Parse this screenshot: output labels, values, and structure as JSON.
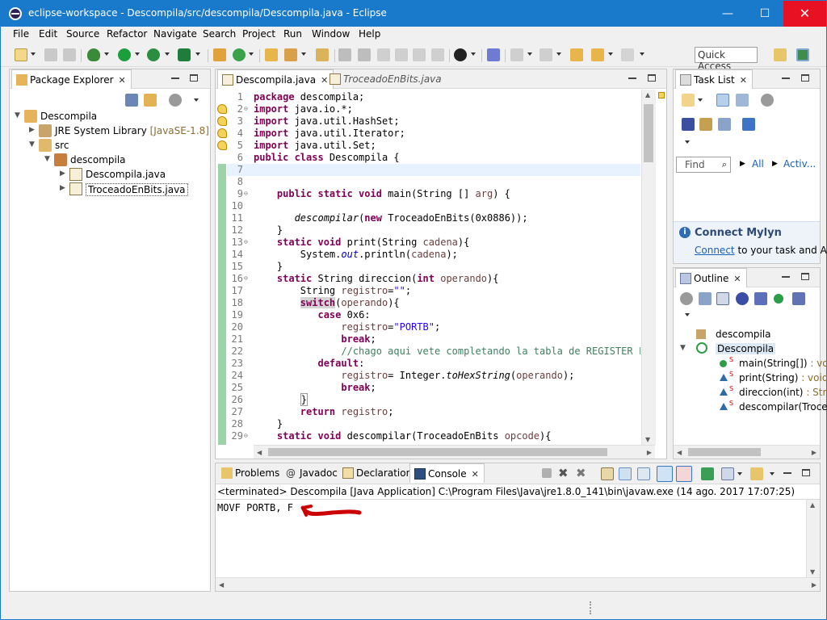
{
  "window": {
    "title": "eclipse-workspace - Descompila/src/descompila/Descompila.java - Eclipse",
    "minimize": "—",
    "maximize": "☐",
    "close": "✕"
  },
  "menu": [
    "File",
    "Edit",
    "Source",
    "Refactor",
    "Navigate",
    "Search",
    "Project",
    "Run",
    "Window",
    "Help"
  ],
  "toolbar": {
    "quick_access_placeholder": "Quick Access"
  },
  "package_explorer": {
    "tab_label": "Package Explorer",
    "tree": [
      {
        "label": "Descompila",
        "decor": "",
        "level": 0
      },
      {
        "label": "JRE System Library",
        "decor": "[JavaSE-1.8]",
        "level": 1
      },
      {
        "label": "src",
        "decor": "",
        "level": 1
      },
      {
        "label": "descompila",
        "decor": "",
        "level": 2
      },
      {
        "label": "Descompila.java",
        "decor": "",
        "level": 3
      },
      {
        "label": "TroceadoEnBits.java",
        "decor": "",
        "level": 3
      }
    ]
  },
  "editor": {
    "tabs": [
      {
        "label": "Descompila.java",
        "active": true
      },
      {
        "label": "TroceadoEnBits.java",
        "active": false
      }
    ],
    "line_numbers": [
      "1",
      "2",
      "3",
      "4",
      "5",
      "6",
      "7",
      "8",
      "9",
      "10",
      "11",
      "12",
      "13",
      "14",
      "15",
      "16",
      "17",
      "18",
      "19",
      "20",
      "21",
      "22",
      "23",
      "24",
      "25",
      "26",
      "27",
      "28",
      "29"
    ]
  },
  "task_list": {
    "tab_label": "Task List",
    "find_placeholder": "Find",
    "all_label": "All",
    "activate_label": "Activ...",
    "connect_title": "Connect Mylyn",
    "connect_link": "Connect",
    "connect_text": " to your task and ALM"
  },
  "outline": {
    "tab_label": "Outline",
    "items": [
      {
        "label": "descompila",
        "type": "",
        "level": 0
      },
      {
        "label": "Descompila",
        "type": "",
        "level": 0
      },
      {
        "label": "main(String[])",
        "type": " : void",
        "level": 1
      },
      {
        "label": "print(String)",
        "type": " : void",
        "level": 1
      },
      {
        "label": "direccion(int)",
        "type": " : String",
        "level": 1
      },
      {
        "label": "descompilar(Troce",
        "type": "",
        "level": 1
      }
    ]
  },
  "console": {
    "tabs": [
      "Problems",
      "Javadoc",
      "Declaration",
      "Console"
    ],
    "terminated": "<terminated> Descompila [Java Application] C:\\Program Files\\Java\\jre1.8.0_141\\bin\\javaw.exe (14 ago. 2017 17:07:25)",
    "output": "MOVF PORTB, F"
  },
  "colors": {
    "titlebar": "#1979ca",
    "close_button": "#e81123",
    "keyword": "#7f0055",
    "string": "#2a00ff",
    "comment": "#3f7f5f",
    "annotation_arrow": "#cc0000"
  }
}
